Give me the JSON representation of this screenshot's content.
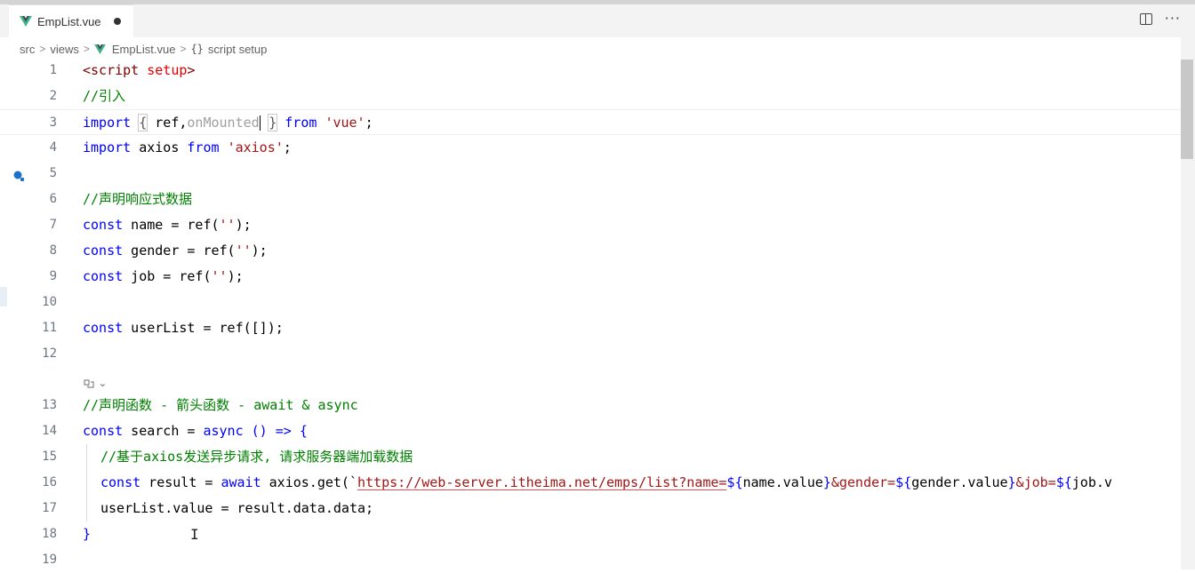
{
  "tab": {
    "filename": "EmpList.vue"
  },
  "breadcrumb": {
    "src": "src",
    "views": "views",
    "file": "EmpList.vue",
    "symbol": "script setup"
  },
  "codelens": "",
  "lines": [
    {
      "n": "1"
    },
    {
      "n": "2"
    },
    {
      "n": "3"
    },
    {
      "n": "4"
    },
    {
      "n": "5"
    },
    {
      "n": "6"
    },
    {
      "n": "7"
    },
    {
      "n": "8"
    },
    {
      "n": "9"
    },
    {
      "n": "10"
    },
    {
      "n": "11"
    },
    {
      "n": "12"
    },
    {
      "n": "13"
    },
    {
      "n": "14"
    },
    {
      "n": "15"
    },
    {
      "n": "16"
    },
    {
      "n": "17"
    },
    {
      "n": "18"
    },
    {
      "n": "19"
    }
  ],
  "code": {
    "l1_open": "<",
    "l1_tag": "script",
    "l1_attr": "setup",
    "l1_close": ">",
    "l2": "//引入",
    "l3_import": "import",
    "l3_ob": "{",
    "l3_ref": " ref,",
    "l3_ghost": "onMounted",
    "l3_cb": "}",
    "l3_from": "from",
    "l3_str": "'vue'",
    "l3_end": ";",
    "l4_import": "import",
    "l4_mid": " axios ",
    "l4_from": "from",
    "l4_str": "'axios'",
    "l4_end": ";",
    "l6": "//声明响应式数据",
    "l7_kw": "const",
    "l7_rest": " name = ref(",
    "l7_str": "''",
    "l7_end": ");",
    "l8_kw": "const",
    "l8_rest": " gender = ref(",
    "l8_str": "''",
    "l8_end": ");",
    "l9_kw": "const",
    "l9_rest": " job = ref(",
    "l9_str": "''",
    "l9_end": ");",
    "l11_kw": "const",
    "l11_rest": " userList = ref([]);",
    "l13": "//声明函数 - 箭头函数 - await & async",
    "l14_kw": "const",
    "l14_mid": " search = ",
    "l14_async": "async",
    "l14_arrow": " () => {",
    "l15": "//基于axios发送异步请求, 请求服务器端加载数据",
    "l16_kw": "const",
    "l16_mid": " result = ",
    "l16_await": "await",
    "l16_call": " axios.get(`",
    "l16_url": "https://web-server.itheima.net/emps/list?name=",
    "l16_t1o": "${",
    "l16_v1": "name.value",
    "l16_t1c": "}",
    "l16_p2": "&gender=",
    "l16_t2o": "${",
    "l16_v2": "gender.value",
    "l16_t2c": "}",
    "l16_p3": "&job=",
    "l16_t3o": "${",
    "l16_v3": "job.v",
    "l17": "userList.value = result.data.data;",
    "l18": "}"
  }
}
